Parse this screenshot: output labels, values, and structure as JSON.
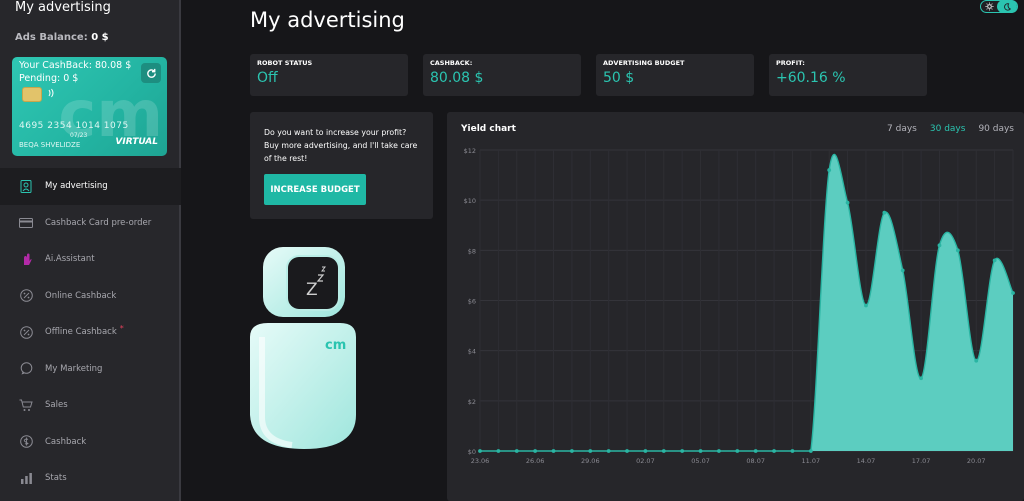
{
  "sidebar": {
    "title": "My advertising",
    "balance_label": "Ads Balance:",
    "balance_value": "0 $",
    "card": {
      "cashback_line": "Your CashBack: 80.08 $",
      "pending_line": "Pending: 0 $",
      "number": "4695 2354 1014 1075",
      "expiry": "07/23",
      "holder": "BEQA SHVELIDZE",
      "badge": "VIRTUAL",
      "logo_text": "cm"
    },
    "items": [
      {
        "label": "My advertising",
        "icon": "robot-icon"
      },
      {
        "label": "Cashback Card pre-order",
        "icon": "credit-card-icon"
      },
      {
        "label": "Ai.Assistant",
        "icon": "hand-icon"
      },
      {
        "label": "Online Cashback",
        "icon": "percent-icon"
      },
      {
        "label": "Offline Cashback",
        "icon": "percent-icon",
        "dot": "*"
      },
      {
        "label": "My Marketing",
        "icon": "chat-icon"
      },
      {
        "label": "Sales",
        "icon": "cart-icon"
      },
      {
        "label": "Cashback",
        "icon": "coin-icon"
      },
      {
        "label": "Stats",
        "icon": "stats-icon"
      }
    ]
  },
  "header": {
    "title": "My advertising"
  },
  "stats": [
    {
      "label": "ROBOT STATUS",
      "value": "Off"
    },
    {
      "label": "CASHBACK:",
      "value": "80.08 $"
    },
    {
      "label": "ADVERTISING BUDGET",
      "value": "50 $"
    },
    {
      "label": "PROFIT:",
      "value": "+60.16 %"
    }
  ],
  "promo": {
    "text": "Do you want to increase your profit? Buy more advertising, and I'll take care of the rest!",
    "button": "INCREASE BUDGET"
  },
  "robot": {
    "sleep_text": "Z",
    "logo_text": "cm"
  },
  "chart": {
    "title": "Yield chart",
    "ranges": [
      "7 days",
      "30 days",
      "90 days"
    ],
    "active_range": "30 days"
  },
  "colors": {
    "accent": "#2bc4b0",
    "area_fill": "#5fd6c8",
    "panel": "#26262a",
    "background": "#161619"
  },
  "chart_data": {
    "type": "area",
    "x": [
      "23.06",
      "24.06",
      "25.06",
      "26.06",
      "27.06",
      "28.06",
      "29.06",
      "30.06",
      "01.07",
      "02.07",
      "03.07",
      "04.07",
      "05.07",
      "06.07",
      "07.07",
      "08.07",
      "09.07",
      "10.07",
      "11.07",
      "12.07",
      "13.07",
      "14.07",
      "15.07",
      "16.07",
      "17.07",
      "18.07",
      "19.07",
      "20.07",
      "21.07",
      "22.07"
    ],
    "tick_labels": [
      "23.06",
      "26.06",
      "29.06",
      "02.07",
      "05.07",
      "08.07",
      "11.07",
      "14.07",
      "17.07",
      "20.07"
    ],
    "values": [
      0,
      0,
      0,
      0,
      0,
      0,
      0,
      0,
      0,
      0,
      0,
      0,
      0,
      0,
      0,
      0,
      0,
      0,
      0,
      11.2,
      9.9,
      5.8,
      9.5,
      7.2,
      2.9,
      8.2,
      8.0,
      3.6,
      7.6,
      6.3
    ],
    "yticks": [
      "$0",
      "$2",
      "$4",
      "$6",
      "$8",
      "$10",
      "$12"
    ],
    "ylim": [
      0,
      12
    ],
    "grid": true
  }
}
